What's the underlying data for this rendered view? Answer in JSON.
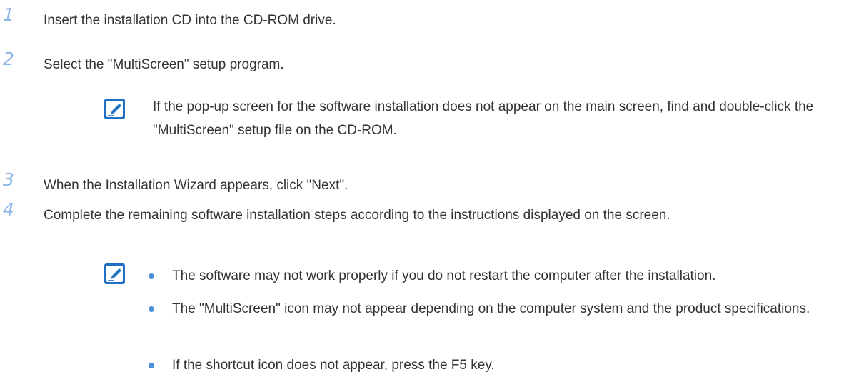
{
  "steps": [
    {
      "number": "1",
      "text": "Insert the installation CD into the CD-ROM drive."
    },
    {
      "number": "2",
      "text": "Select the \"MultiScreen\" setup program."
    },
    {
      "number": "3",
      "text": "When the Installation Wizard appears, click \"Next\"."
    },
    {
      "number": "4",
      "text": "Complete the remaining software installation steps according to the instructions displayed on the screen."
    }
  ],
  "note1": {
    "icon": "note-pencil-icon",
    "text": "If the pop-up screen for the software installation does not appear on the main screen, find and double-click the \"MultiScreen\" setup file on the CD-ROM."
  },
  "note2": {
    "icon": "note-pencil-icon",
    "bullets": [
      "The software may not work properly if you do not restart the computer after the installation.",
      "The \"MultiScreen\" icon may not appear depending on the computer system and the product specifications.",
      "If the shortcut icon does not appear, press the F5 key."
    ]
  },
  "colors": {
    "step_number": "#8ab4e8",
    "note_icon": "#1f6fc5",
    "bullet": "#4a8fd8",
    "text": "#333333"
  }
}
